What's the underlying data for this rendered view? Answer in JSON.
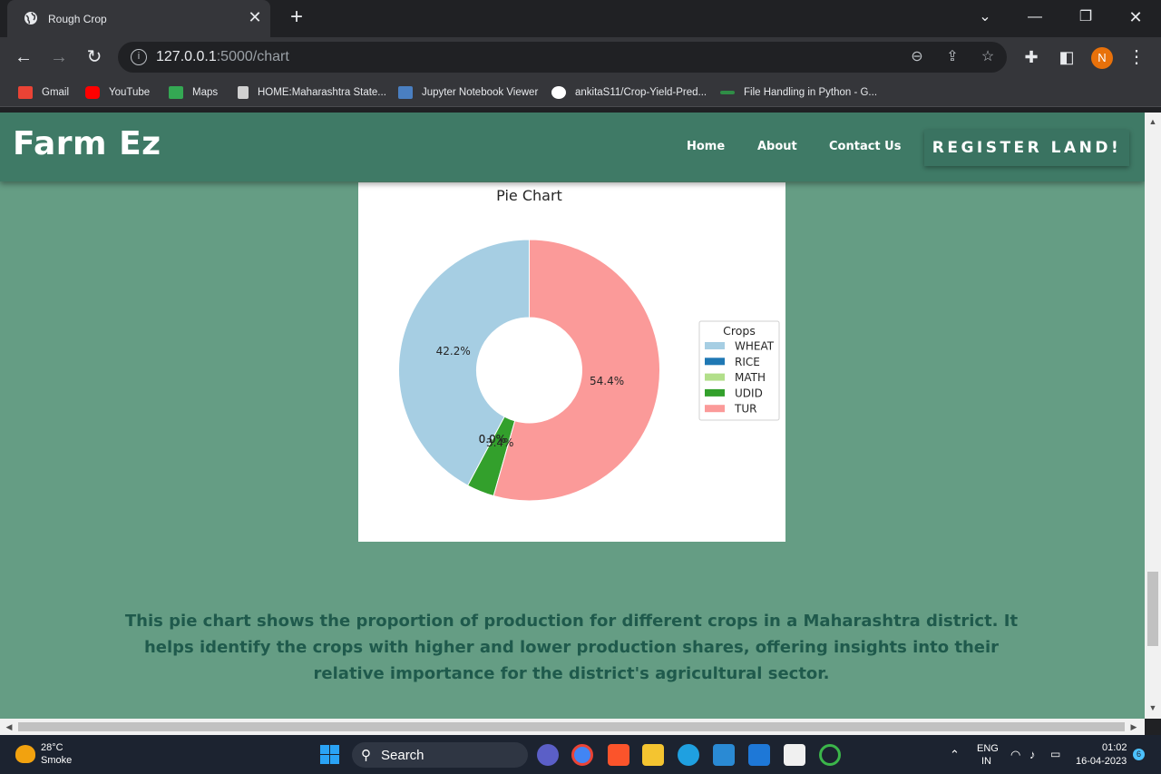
{
  "browser": {
    "tab_title": "Rough Crop",
    "url_host": "127.0.0.1",
    "url_path": ":5000/chart",
    "profile_initial": "N",
    "bookmarks": [
      {
        "label": "Gmail",
        "icon": "gmail-icon",
        "color": "#ea4335"
      },
      {
        "label": "YouTube",
        "icon": "youtube-icon",
        "color": "#ff0000"
      },
      {
        "label": "Maps",
        "icon": "maps-icon",
        "color": "#34a853"
      },
      {
        "label": "HOME:Maharashtra State...",
        "icon": "document-icon",
        "color": "#d0d0d0"
      },
      {
        "label": "Jupyter Notebook Viewer",
        "icon": "jupyter-icon",
        "color": "#4a7fc1"
      },
      {
        "label": "ankitaS11/Crop-Yield-Pred...",
        "icon": "github-icon",
        "color": "#ffffff"
      },
      {
        "label": "File Handling in Python - G...",
        "icon": "gfg-icon",
        "color": "#2f8d46"
      }
    ]
  },
  "site": {
    "logo": "Farm Ez",
    "nav": {
      "home": "Home",
      "about": "About",
      "contact": "Contact Us"
    },
    "register": "REGISTER LAND!",
    "description": "This pie chart shows the proportion of production for different crops in a Maharashtra district. It helps identify the crops with higher and lower production shares, offering insights into their relative importance for the district's agricultural sector."
  },
  "chart_data": {
    "type": "pie",
    "title": "Pie Chart",
    "donut": true,
    "legend_title": "Crops",
    "legend_position": "right",
    "categories": [
      "WHEAT",
      "RICE",
      "MATH",
      "UDID",
      "TUR"
    ],
    "values": [
      42.2,
      0.0,
      0.0,
      3.4,
      54.4
    ],
    "labels": [
      "42.2%",
      "0.0%",
      "0.0%",
      "3.4%",
      "54.4%"
    ],
    "colors": [
      "#a6cee3",
      "#1f78b4",
      "#b2df8a",
      "#33a02c",
      "#fb9a99"
    ]
  },
  "taskbar": {
    "temperature": "28°C",
    "weather": "Smoke",
    "search": "Search",
    "lang_top": "ENG",
    "lang_bottom": "IN",
    "time": "01:02",
    "date": "16-04-2023",
    "notifications": "6"
  }
}
